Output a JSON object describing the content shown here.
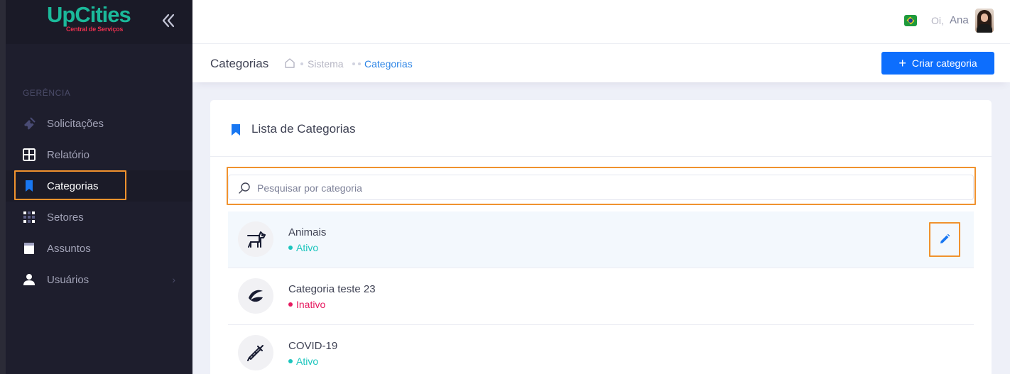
{
  "app": {
    "logo_main": "UpCities",
    "logo_sub": "Central de Serviços"
  },
  "sidebar": {
    "section_label": "GERÊNCIA",
    "items": [
      {
        "label": "Solicitações",
        "icon": "ticket-icon",
        "active": false
      },
      {
        "label": "Relatório",
        "icon": "grid-icon",
        "active": false
      },
      {
        "label": "Categorias",
        "icon": "bookmark-icon",
        "active": true
      },
      {
        "label": "Setores",
        "icon": "dots-grid-icon",
        "active": false
      },
      {
        "label": "Assuntos",
        "icon": "book-icon",
        "active": false
      },
      {
        "label": "Usuários",
        "icon": "user-icon",
        "active": false,
        "has_submenu": true
      }
    ]
  },
  "header": {
    "greeting": "Oi,",
    "username": "Ana"
  },
  "subheader": {
    "title": "Categorias",
    "breadcrumb": [
      "Sistema",
      "Categorias"
    ],
    "create_button": "Criar categoria"
  },
  "card": {
    "title": "Lista de Categorias",
    "search_placeholder": "Pesquisar por categoria"
  },
  "categories": [
    {
      "name": "Animais",
      "status": "Ativo",
      "icon": "dog-icon"
    },
    {
      "name": "Categoria teste 23",
      "status": "Inativo",
      "icon": "leaf-icon"
    },
    {
      "name": "COVID-19",
      "status": "Ativo",
      "icon": "syringe-icon"
    }
  ],
  "colors": {
    "sidebar_bg": "#1e1e2d",
    "accent_blue": "#0d6efd",
    "brand_green": "#1bb99a",
    "brand_red": "#e8304f",
    "status_active": "#1bc5bd",
    "status_inactive": "#e6195f",
    "highlight_orange": "#f0922e"
  }
}
